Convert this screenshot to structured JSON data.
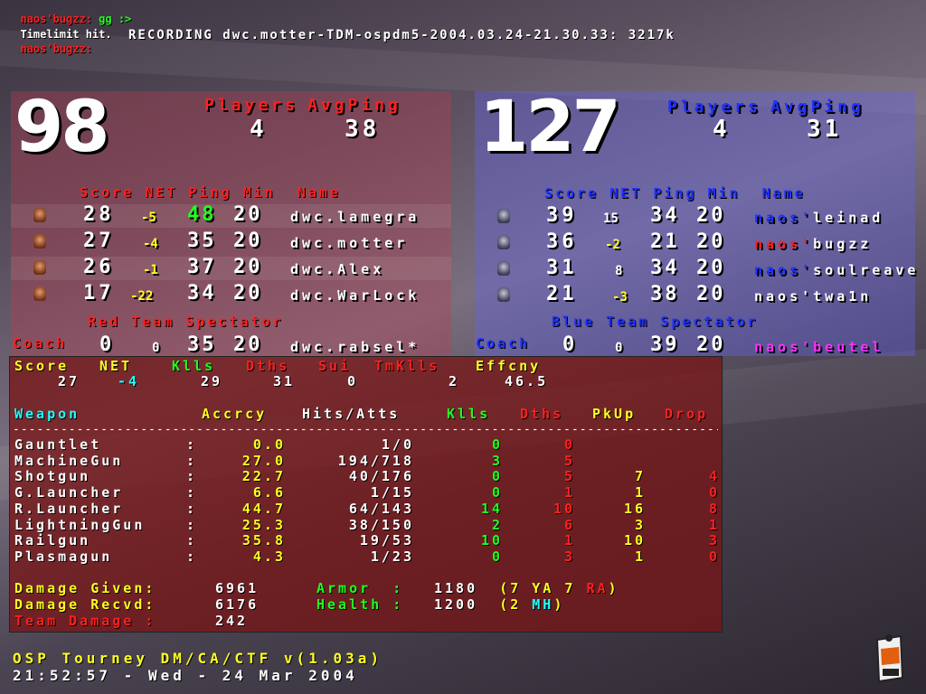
{
  "chat": [
    {
      "name": "naos'bugzz:",
      "msg": " gg :>"
    },
    {
      "name": "",
      "msg": "Timelimit hit."
    },
    {
      "name": "naos'bugzz:",
      "msg": ""
    }
  ],
  "recording": "RECORDING dwc.motter-TDM-ospdm5-2004.03.24-21.30.33: 3217k",
  "red_team": {
    "score": "98",
    "players_label": "Players",
    "avgping_label": "AvgPing",
    "players": "4",
    "avgping": "38",
    "col_headers": {
      "score": "Score",
      "net": "NET",
      "ping": "Ping",
      "min": "Min",
      "name": "Name"
    },
    "rows": [
      {
        "score": "28",
        "net": "-5",
        "ping": "48",
        "min": "20",
        "name": "dwc.lamegra"
      },
      {
        "score": "27",
        "net": "-4",
        "ping": "35",
        "min": "20",
        "name": "dwc.motter"
      },
      {
        "score": "26",
        "net": "-1",
        "ping": "37",
        "min": "20",
        "name": "dwc.Alex"
      },
      {
        "score": "17",
        "net": "-22",
        "ping": "34",
        "min": "20",
        "name": "dwc.WarLock"
      }
    ],
    "spectator_label": "Red Team Spectator",
    "coach": {
      "label": "Coach",
      "score": "0",
      "net": "0",
      "ping": "35",
      "min": "20",
      "name": "dwc.rabsel*"
    }
  },
  "blue_team": {
    "score": "127",
    "players_label": "Players",
    "avgping_label": "AvgPing",
    "players": "4",
    "avgping": "31",
    "col_headers": {
      "score": "Score",
      "net": "NET",
      "ping": "Ping",
      "min": "Min",
      "name": "Name"
    },
    "rows": [
      {
        "score": "39",
        "net": "15",
        "ping": "34",
        "min": "20",
        "name_a": "naos'",
        "name_b": "leinad"
      },
      {
        "score": "36",
        "net": "-2",
        "ping": "21",
        "min": "20",
        "name_a": "naos'",
        "name_b": "bugzz"
      },
      {
        "score": "31",
        "net": "8",
        "ping": "34",
        "min": "20",
        "name_a": "naos'",
        "name_b": "soulreave"
      },
      {
        "score": "21",
        "net": "-3",
        "ping": "38",
        "min": "20",
        "name_a": "naos'",
        "name_b": "twa1n"
      }
    ],
    "spectator_label": "Blue Team Spectator",
    "coach": {
      "label": "Coach",
      "score": "0",
      "net": "0",
      "ping": "39",
      "min": "20",
      "name": "naos'beutel"
    }
  },
  "stats": {
    "summary_headers": {
      "score": "Score",
      "net": "NET",
      "kills": "Klls",
      "deaths": "Dths",
      "sui": "Sui",
      "tmkills": "TmKlls",
      "effcny": "Effcny"
    },
    "summary_values": {
      "score": "27",
      "net": "-4",
      "kills": "29",
      "deaths": "31",
      "sui": "0",
      "tmkills": "2",
      "effcny": "46.5"
    },
    "weapon_headers": {
      "weapon": "Weapon",
      "accrcy": "Accrcy",
      "hits": "Hits/Atts",
      "kills": "Klls",
      "deaths": "Dths",
      "pickup": "PkUp",
      "drop": "Drop"
    },
    "divider": "------------------------------------------------------------------------------------------",
    "weapons": [
      {
        "name": "Gauntlet",
        "sep": ":",
        "acc": "0.0",
        "hits": "1/0",
        "kills": "0",
        "deaths": "0",
        "pickup": "",
        "drop": ""
      },
      {
        "name": "MachineGun",
        "sep": ":",
        "acc": "27.0",
        "hits": "194/718",
        "kills": "3",
        "deaths": "5",
        "pickup": "",
        "drop": ""
      },
      {
        "name": "Shotgun",
        "sep": ":",
        "acc": "22.7",
        "hits": "40/176",
        "kills": "0",
        "deaths": "5",
        "pickup": "7",
        "drop": "4"
      },
      {
        "name": "G.Launcher",
        "sep": ":",
        "acc": "6.6",
        "hits": "1/15",
        "kills": "0",
        "deaths": "1",
        "pickup": "1",
        "drop": "0"
      },
      {
        "name": "R.Launcher",
        "sep": ":",
        "acc": "44.7",
        "hits": "64/143",
        "kills": "14",
        "deaths": "10",
        "pickup": "16",
        "drop": "8"
      },
      {
        "name": "LightningGun",
        "sep": ":",
        "acc": "25.3",
        "hits": "38/150",
        "kills": "2",
        "deaths": "6",
        "pickup": "3",
        "drop": "1"
      },
      {
        "name": "Railgun",
        "sep": ":",
        "acc": "35.8",
        "hits": "19/53",
        "kills": "10",
        "deaths": "1",
        "pickup": "10",
        "drop": "3"
      },
      {
        "name": "Plasmagun",
        "sep": ":",
        "acc": "4.3",
        "hits": "1/23",
        "kills": "0",
        "deaths": "3",
        "pickup": "1",
        "drop": "0"
      }
    ],
    "damage_given_label": "Damage Given:",
    "damage_given": "6961",
    "damage_recvd_label": "Damage Recvd:",
    "damage_recvd": "6176",
    "team_damage_label": "Team Damage :",
    "team_damage": "242",
    "armor_label": "Armor  :",
    "armor_value": "1180",
    "armor_detail_a": "(7 YA 7 ",
    "armor_detail_b": "RA",
    "armor_detail_c": ")",
    "health_label": "Health :",
    "health_value": "1200",
    "health_detail_a": "(2 ",
    "health_detail_b": "MH",
    "health_detail_c": ")"
  },
  "footer": {
    "version": "OSP Tourney DM/CA/CTF v(1.03a)",
    "datetime": "21:52:57 - Wed - 24 Mar 2004"
  }
}
